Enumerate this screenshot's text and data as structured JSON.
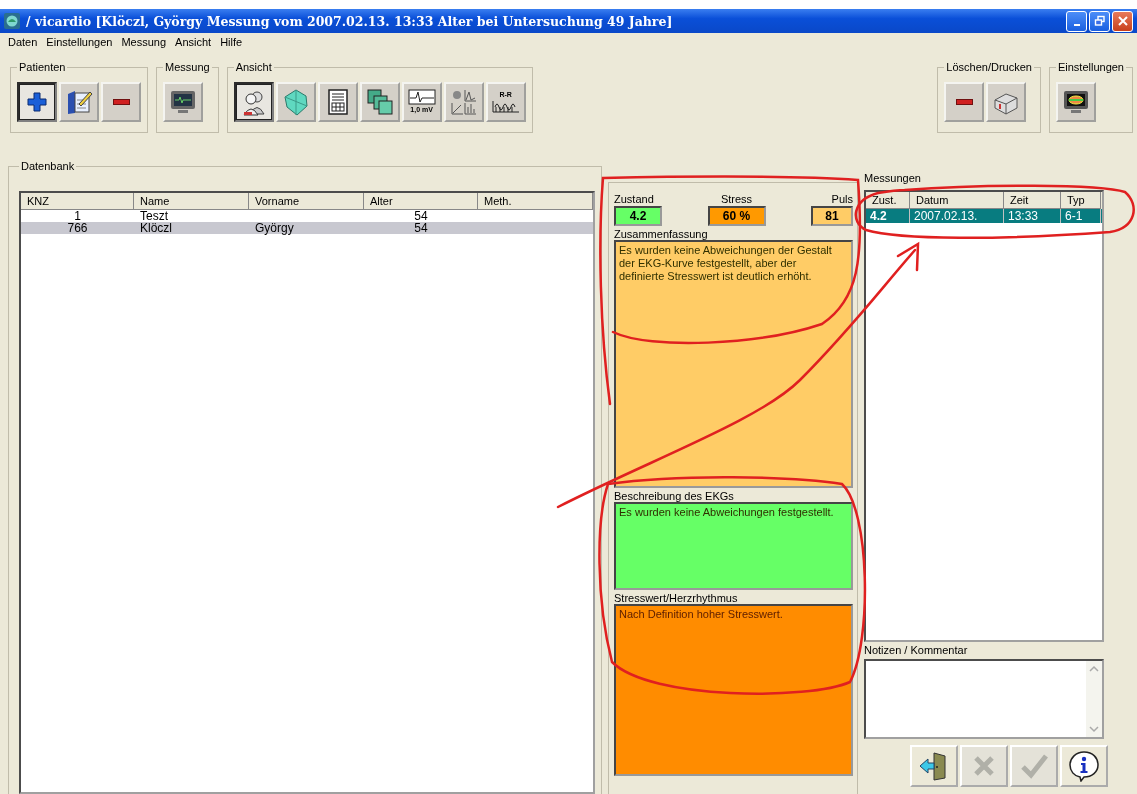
{
  "window": {
    "title": "/ vicardio [Klöczl, György Messung vom 2007.02.13. 13:33 Alter bei Untersuchung 49 Jahre]"
  },
  "menu": [
    "Daten",
    "Einstellungen",
    "Messung",
    "Ansicht",
    "Hilfe"
  ],
  "toolbar_left": [
    {
      "title": "Patienten",
      "buttons": [
        {
          "kind": "add",
          "selected": true
        },
        {
          "kind": "edit",
          "selected": false
        },
        {
          "kind": "delete",
          "selected": false
        }
      ]
    },
    {
      "title": "Messung",
      "buttons": [
        {
          "kind": "monitor",
          "selected": false
        }
      ]
    },
    {
      "title": "Ansicht",
      "buttons": [
        {
          "kind": "patient",
          "selected": true
        },
        {
          "kind": "heart",
          "selected": false
        },
        {
          "kind": "report",
          "selected": false
        },
        {
          "kind": "pages",
          "selected": false
        },
        {
          "kind": "ecg",
          "label": "1,0 mV",
          "selected": false
        },
        {
          "kind": "charts",
          "selected": false
        },
        {
          "kind": "rr",
          "label": "R-R",
          "selected": false
        }
      ]
    }
  ],
  "toolbar_right": [
    {
      "title": "Löschen/Drucken",
      "buttons": [
        {
          "kind": "delete",
          "selected": false
        },
        {
          "kind": "printer",
          "selected": false
        }
      ]
    },
    {
      "title": "Einstellungen",
      "buttons": [
        {
          "kind": "settings",
          "selected": false
        }
      ]
    }
  ],
  "database": {
    "title": "Datenbank",
    "columns": [
      "KNZ",
      "Name",
      "Vorname",
      "Alter",
      "Meth."
    ],
    "rows": [
      {
        "cells": [
          "1",
          "Teszt",
          "",
          "54",
          ""
        ],
        "selected": false
      },
      {
        "cells": [
          "766",
          "Klöczl",
          "György",
          "54",
          ""
        ],
        "selected": true
      }
    ]
  },
  "summary": {
    "metrics": [
      {
        "label": "Zustand",
        "value": "4.2",
        "color": "#66ff66"
      },
      {
        "label": "Stress",
        "value": "60 %",
        "color": "#ff9900"
      },
      {
        "label": "Puls",
        "value": "81",
        "color": "#ffcc66"
      }
    ],
    "sections": [
      {
        "title": "Zusammenfassung",
        "text": "Es wurden keine Abweichungen der Gestalt der EKG-Kurve festgestellt, aber der definierte Stresswert ist deutlich erhöht.",
        "color": "#ffcc66"
      },
      {
        "title": "Beschreibung des EKGs",
        "text": "Es wurden keine Abweichungen festgestellt.",
        "color": "#66ff66"
      },
      {
        "title": "Stresswert/Herzrhythmus",
        "text": "Nach Definition hoher Stresswert.",
        "color": "#ff8c00"
      }
    ]
  },
  "measurements": {
    "title": "Messungen",
    "columns": [
      "Zust.",
      "Datum",
      "Zeit",
      "Typ"
    ],
    "rows": [
      {
        "cells": [
          "4.2",
          "2007.02.13.",
          "13:33",
          "6-1"
        ],
        "selected": true
      }
    ]
  },
  "notes": {
    "title": "Notizen / Kommentar"
  },
  "actions": [
    {
      "kind": "exit",
      "disabled": false
    },
    {
      "kind": "cancel",
      "disabled": true
    },
    {
      "kind": "confirm",
      "disabled": true
    },
    {
      "kind": "info",
      "disabled": false
    }
  ]
}
